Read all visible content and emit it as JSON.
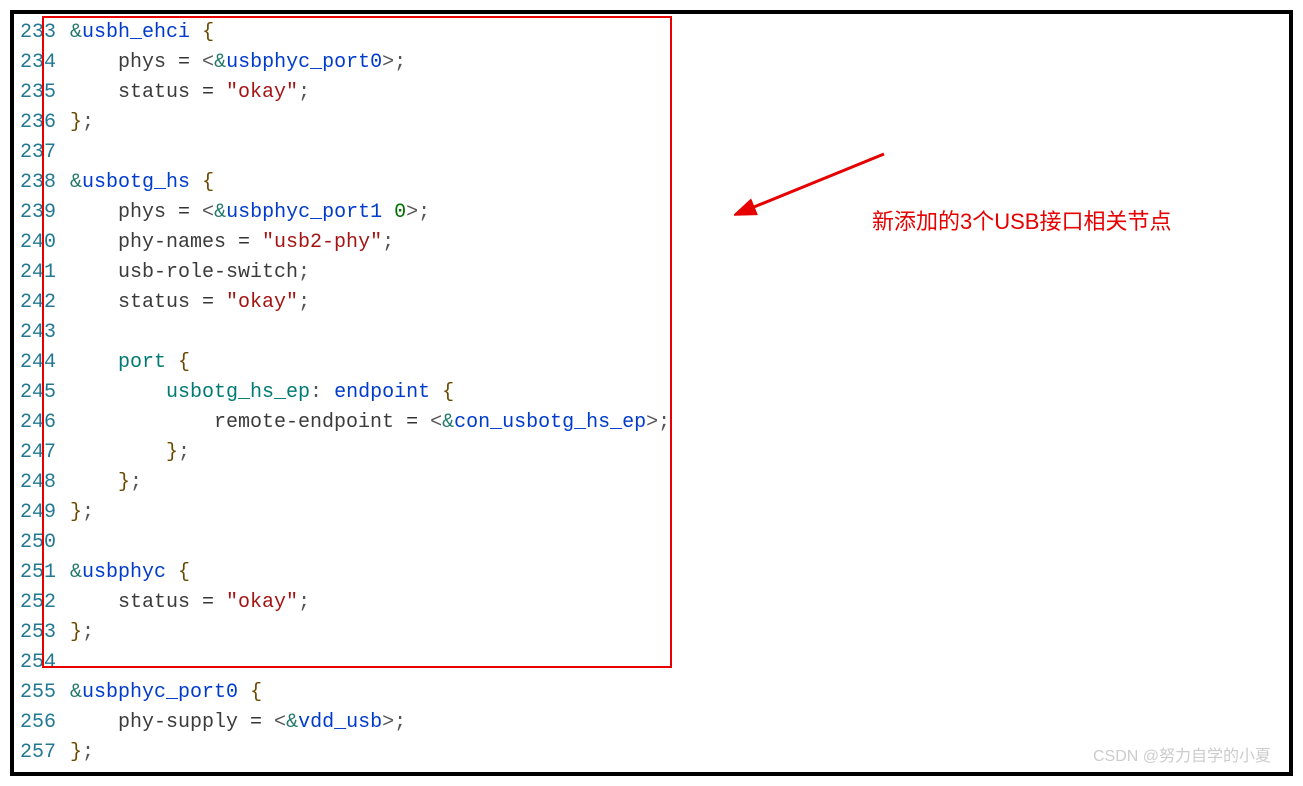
{
  "annotation_text": "新添加的3个USB接口相关节点",
  "watermark": "CSDN @努力自学的小夏",
  "lines": [
    {
      "n": 233,
      "tokens": [
        [
          "&",
          "amp"
        ],
        [
          "usbh_ehci",
          "ident"
        ],
        [
          " ",
          "p"
        ],
        [
          "{",
          "brace"
        ]
      ]
    },
    {
      "n": 234,
      "tokens": [
        [
          "    phys ",
          "prop"
        ],
        [
          "= ",
          "eq"
        ],
        [
          "<",
          "punct"
        ],
        [
          "&",
          "amp"
        ],
        [
          "usbphyc_port0",
          "ident"
        ],
        [
          ">",
          "punct"
        ],
        [
          ";",
          "punct"
        ]
      ]
    },
    {
      "n": 235,
      "tokens": [
        [
          "    status ",
          "prop"
        ],
        [
          "= ",
          "eq"
        ],
        [
          "\"okay\"",
          "str"
        ],
        [
          ";",
          "punct"
        ]
      ]
    },
    {
      "n": 236,
      "tokens": [
        [
          "}",
          "brace"
        ],
        [
          ";",
          "punct"
        ]
      ]
    },
    {
      "n": 237,
      "tokens": []
    },
    {
      "n": 238,
      "tokens": [
        [
          "&",
          "amp"
        ],
        [
          "usbotg_hs",
          "ident"
        ],
        [
          " ",
          "p"
        ],
        [
          "{",
          "brace"
        ]
      ]
    },
    {
      "n": 239,
      "tokens": [
        [
          "    phys ",
          "prop"
        ],
        [
          "= ",
          "eq"
        ],
        [
          "<",
          "punct"
        ],
        [
          "&",
          "amp"
        ],
        [
          "usbphyc_port1",
          "ident"
        ],
        [
          " ",
          "p"
        ],
        [
          "0",
          "num"
        ],
        [
          ">",
          "punct"
        ],
        [
          ";",
          "punct"
        ]
      ]
    },
    {
      "n": 240,
      "tokens": [
        [
          "    phy-names ",
          "prop"
        ],
        [
          "= ",
          "eq"
        ],
        [
          "\"usb2-phy\"",
          "str"
        ],
        [
          ";",
          "punct"
        ]
      ]
    },
    {
      "n": 241,
      "tokens": [
        [
          "    usb-role-switch",
          "prop"
        ],
        [
          ";",
          "punct"
        ]
      ]
    },
    {
      "n": 242,
      "tokens": [
        [
          "    status ",
          "prop"
        ],
        [
          "= ",
          "eq"
        ],
        [
          "\"okay\"",
          "str"
        ],
        [
          ";",
          "punct"
        ]
      ]
    },
    {
      "n": 243,
      "tokens": []
    },
    {
      "n": 244,
      "tokens": [
        [
          "    ",
          "p"
        ],
        [
          "port",
          "func"
        ],
        [
          " ",
          "p"
        ],
        [
          "{",
          "brace"
        ]
      ]
    },
    {
      "n": 245,
      "tokens": [
        [
          "        ",
          "p"
        ],
        [
          "usbotg_hs_ep",
          "func"
        ],
        [
          ": ",
          "punct"
        ],
        [
          "endpoint",
          "ident"
        ],
        [
          " ",
          "p"
        ],
        [
          "{",
          "brace"
        ]
      ]
    },
    {
      "n": 246,
      "tokens": [
        [
          "            remote-endpoint ",
          "prop"
        ],
        [
          "= ",
          "eq"
        ],
        [
          "<",
          "punct"
        ],
        [
          "&",
          "amp"
        ],
        [
          "con_usbotg_hs_ep",
          "ident"
        ],
        [
          ">",
          "punct"
        ],
        [
          ";",
          "punct"
        ]
      ]
    },
    {
      "n": 247,
      "tokens": [
        [
          "        ",
          "p"
        ],
        [
          "}",
          "brace"
        ],
        [
          ";",
          "punct"
        ]
      ]
    },
    {
      "n": 248,
      "tokens": [
        [
          "    ",
          "p"
        ],
        [
          "}",
          "brace"
        ],
        [
          ";",
          "punct"
        ]
      ]
    },
    {
      "n": 249,
      "tokens": [
        [
          "}",
          "brace"
        ],
        [
          ";",
          "punct"
        ]
      ]
    },
    {
      "n": 250,
      "tokens": []
    },
    {
      "n": 251,
      "tokens": [
        [
          "&",
          "amp"
        ],
        [
          "usbphyc",
          "ident"
        ],
        [
          " ",
          "p"
        ],
        [
          "{",
          "brace"
        ]
      ]
    },
    {
      "n": 252,
      "tokens": [
        [
          "    status ",
          "prop"
        ],
        [
          "= ",
          "eq"
        ],
        [
          "\"okay\"",
          "str"
        ],
        [
          ";",
          "punct"
        ]
      ]
    },
    {
      "n": 253,
      "tokens": [
        [
          "}",
          "brace"
        ],
        [
          ";",
          "punct"
        ]
      ]
    },
    {
      "n": 254,
      "tokens": []
    },
    {
      "n": 255,
      "tokens": [
        [
          "&",
          "amp"
        ],
        [
          "usbphyc_port0",
          "ident"
        ],
        [
          " ",
          "p"
        ],
        [
          "{",
          "brace"
        ]
      ]
    },
    {
      "n": 256,
      "tokens": [
        [
          "    phy-supply ",
          "prop"
        ],
        [
          "= ",
          "eq"
        ],
        [
          "<",
          "punct"
        ],
        [
          "&",
          "amp"
        ],
        [
          "vdd_usb",
          "ident"
        ],
        [
          ">",
          "punct"
        ],
        [
          ";",
          "punct"
        ]
      ]
    },
    {
      "n": 257,
      "tokens": [
        [
          "}",
          "brace"
        ],
        [
          ";",
          "punct"
        ]
      ]
    }
  ]
}
